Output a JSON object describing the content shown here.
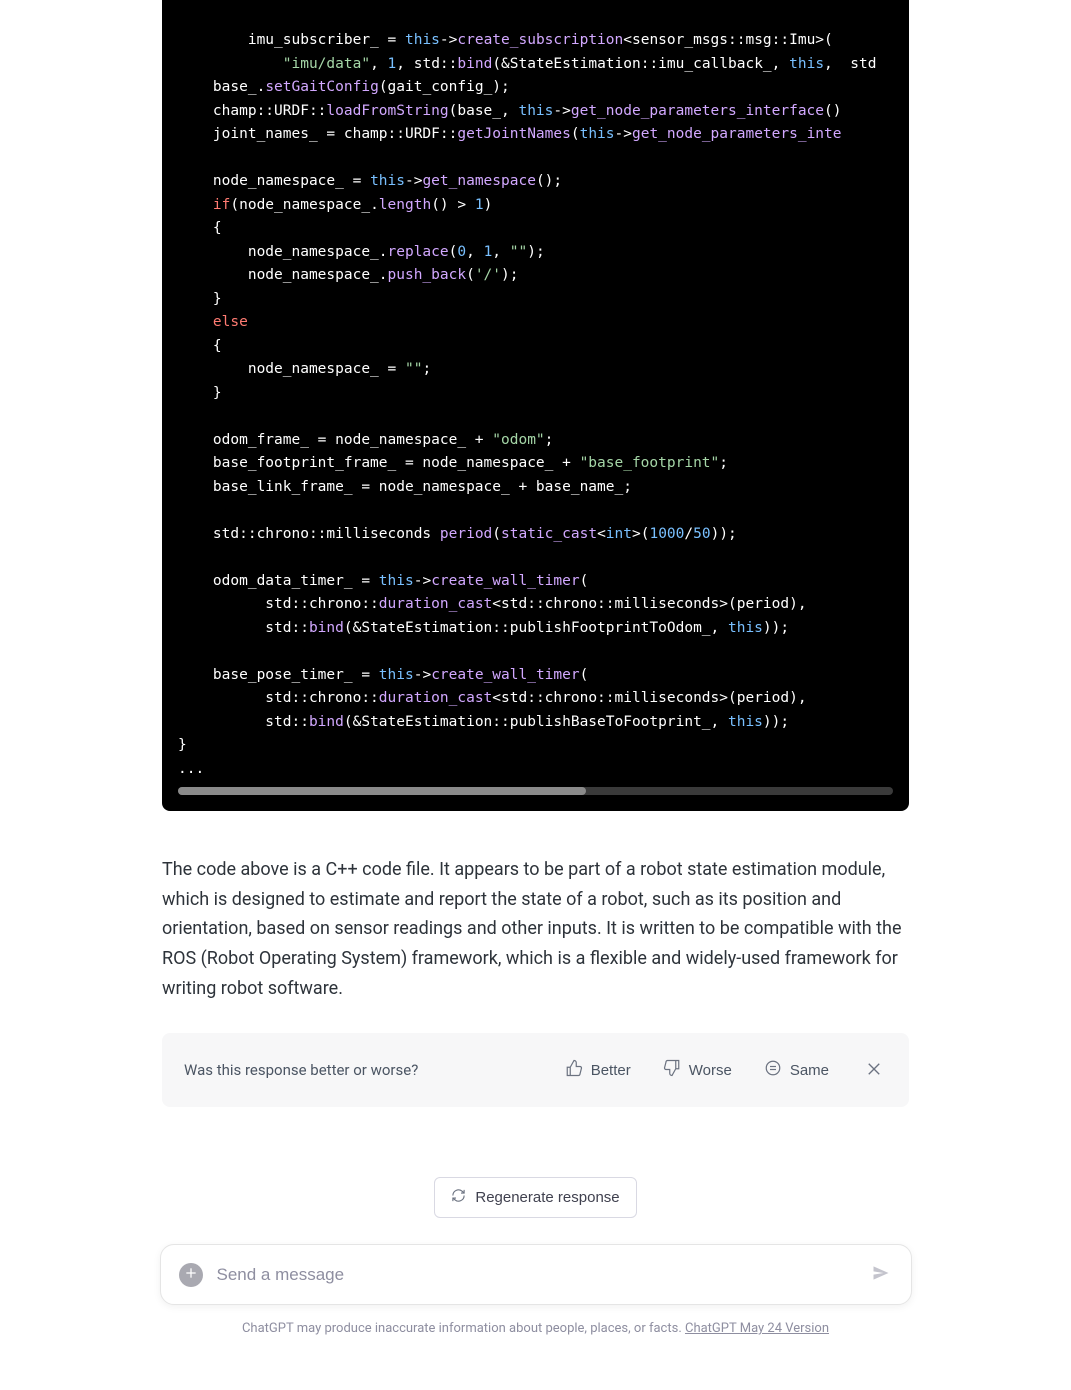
{
  "explanation": "The code above is a C++ code file. It appears to be part of a robot state estimation module, which is designed to estimate and report the state of a robot, such as its position and orientation, based on sensor readings and other inputs. It is written to be compatible with the ROS (Robot Operating System) framework, which is a flexible and widely-used framework for writing robot software.",
  "feedback": {
    "prompt": "Was this response better or worse?",
    "better": "Better",
    "worse": "Worse",
    "same": "Same"
  },
  "regenerate_label": "Regenerate response",
  "input_placeholder": "Send a message",
  "footer": {
    "disclaimer": "ChatGPT may produce inaccurate information about people, places, or facts. ",
    "version_link": "ChatGPT May 24 Version"
  },
  "code": {
    "l1a": "        imu_subscriber_ = ",
    "l1b": "this",
    "l1c": "->",
    "l1d": "create_subscription",
    "l1e": "<sensor_msgs::msg::Imu>(",
    "l2a": "            ",
    "l2b": "\"imu/data\"",
    "l2c": ", ",
    "l2d": "1",
    "l2e": ", std::",
    "l2f": "bind",
    "l2g": "(&StateEstimation::imu_callback_, ",
    "l2h": "this",
    "l2i": ",  std",
    "l3a": "    base_.",
    "l3b": "setGaitConfig",
    "l3c": "(gait_config_);",
    "l4a": "    champ::URDF::",
    "l4b": "loadFromString",
    "l4c": "(base_, ",
    "l4d": "this",
    "l4e": "->",
    "l4f": "get_node_parameters_interface",
    "l4g": "()",
    "l5a": "    joint_names_ = champ::URDF::",
    "l5b": "getJointNames",
    "l5c": "(",
    "l5d": "this",
    "l5e": "->",
    "l5f": "get_node_parameters_inte",
    "blank": "",
    "l6a": "    node_namespace_ = ",
    "l6b": "this",
    "l6c": "->",
    "l6d": "get_namespace",
    "l6e": "();",
    "l7a": "    ",
    "l7b": "if",
    "l7c": "(node_namespace_.",
    "l7d": "length",
    "l7e": "() > ",
    "l7f": "1",
    "l7g": ")",
    "l8": "    {",
    "l9a": "        node_namespace_.",
    "l9b": "replace",
    "l9c": "(",
    "l9d": "0",
    "l9e": ", ",
    "l9f": "1",
    "l9g": ", ",
    "l9h": "\"\"",
    "l9i": ");",
    "l10a": "        node_namespace_.",
    "l10b": "push_back",
    "l10c": "(",
    "l10d": "'/'",
    "l10e": ");",
    "l11": "    }",
    "l12a": "    ",
    "l12b": "else",
    "l13": "    {",
    "l14a": "        node_namespace_ = ",
    "l14b": "\"\"",
    "l14c": ";",
    "l15": "    }",
    "l16a": "    odom_frame_ = node_namespace_ + ",
    "l16b": "\"odom\"",
    "l16c": ";",
    "l17a": "    base_footprint_frame_ = node_namespace_ + ",
    "l17b": "\"base_footprint\"",
    "l17c": ";",
    "l18": "    base_link_frame_ = node_namespace_ + base_name_;",
    "l19a": "    std::chrono::milliseconds ",
    "l19b": "period",
    "l19c": "(",
    "l19d": "static_cast",
    "l19e": "<",
    "l19f": "int",
    "l19g": ">(",
    "l19h": "1000",
    "l19i": "/",
    "l19j": "50",
    "l19k": "));",
    "l20a": "    odom_data_timer_ = ",
    "l20b": "this",
    "l20c": "->",
    "l20d": "create_wall_timer",
    "l20e": "(",
    "l21a": "          std::chrono::",
    "l21b": "duration_cast",
    "l21c": "<std::chrono::milliseconds>(period),",
    "l22a": "          std::",
    "l22b": "bind",
    "l22c": "(&StateEstimation::publishFootprintToOdom_, ",
    "l22d": "this",
    "l22e": "));",
    "l23a": "    base_pose_timer_ = ",
    "l23b": "this",
    "l23c": "->",
    "l23d": "create_wall_timer",
    "l23e": "(",
    "l24a": "          std::chrono::",
    "l24b": "duration_cast",
    "l24c": "<std::chrono::milliseconds>(period),",
    "l25a": "          std::",
    "l25b": "bind",
    "l25c": "(&StateEstimation::publishBaseToFootprint_, ",
    "l25d": "this",
    "l25e": "));",
    "l26": "}",
    "l27": "..."
  }
}
